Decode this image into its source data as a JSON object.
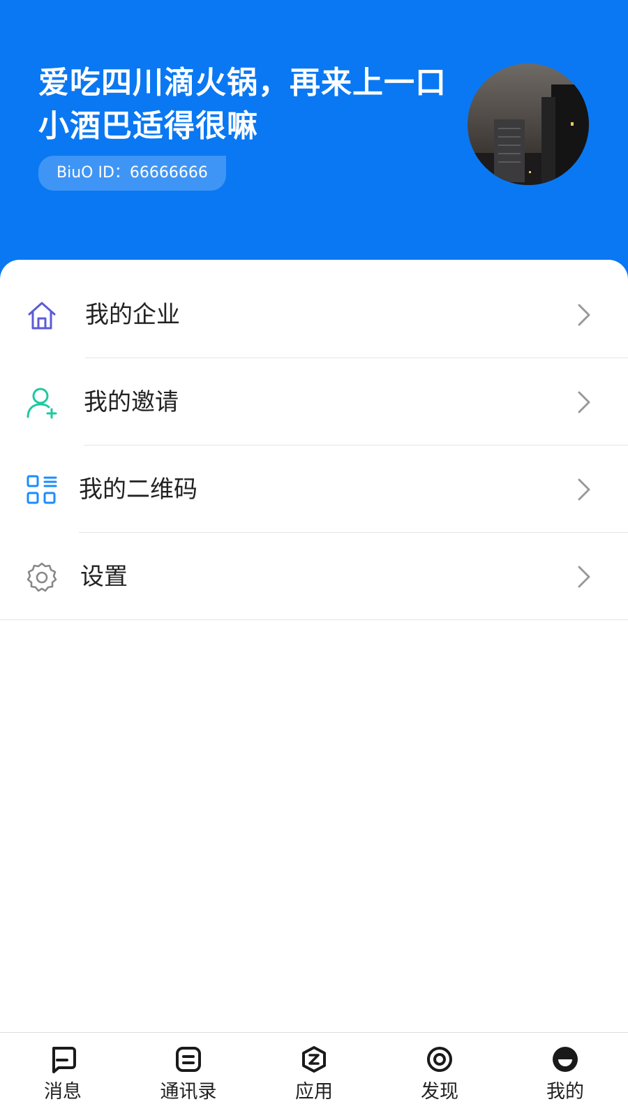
{
  "profile": {
    "nickname": "爱吃四川滴火锅，再来上一口小酒巴适得很嘛",
    "id_label": "BiuO ID：66666666",
    "avatar_icon": "avatar-photo-city-night"
  },
  "menu": [
    {
      "label": "我的企业",
      "icon": "home-icon",
      "color": "#5b5bd6"
    },
    {
      "label": "我的邀请",
      "icon": "add-user-icon",
      "color": "#1ec8a0"
    },
    {
      "label": "我的二维码",
      "icon": "qr-code-icon",
      "color": "#1a8cff"
    },
    {
      "label": "设置",
      "icon": "gear-icon",
      "color": "#888888"
    }
  ],
  "tabbar": [
    {
      "label": "消息",
      "icon": "message-icon"
    },
    {
      "label": "通讯录",
      "icon": "contacts-icon"
    },
    {
      "label": "应用",
      "icon": "apps-icon"
    },
    {
      "label": "发现",
      "icon": "discover-icon"
    },
    {
      "label": "我的",
      "icon": "profile-icon",
      "active": true
    }
  ],
  "colors": {
    "header_bg": "#0a78f2",
    "text": "#222222",
    "chevron": "#999999"
  }
}
